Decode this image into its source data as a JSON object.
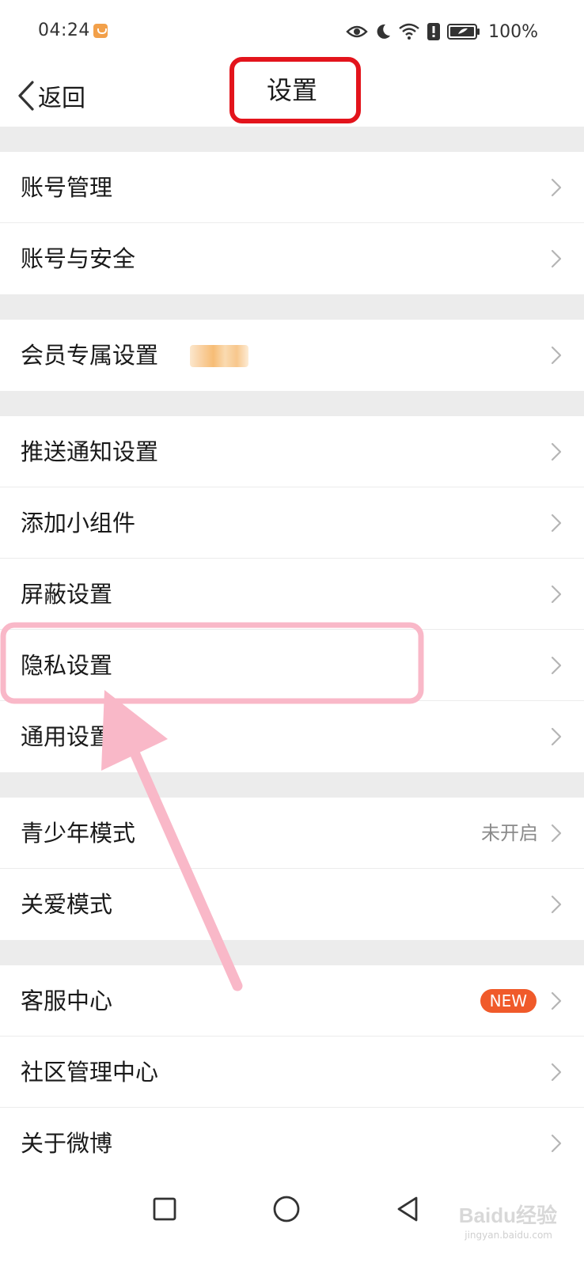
{
  "status_bar": {
    "time": "04:24",
    "battery_percent": "100%",
    "icons": [
      "weibo-app-icon",
      "eye-icon",
      "moon-icon",
      "wifi-icon",
      "alert-icon",
      "battery-icon"
    ]
  },
  "nav": {
    "back_label": "返回",
    "title": "设置"
  },
  "groups": [
    {
      "items": [
        {
          "label": "账号管理"
        },
        {
          "label": "账号与安全"
        }
      ]
    },
    {
      "items": [
        {
          "label": "会员专属设置"
        }
      ]
    },
    {
      "items": [
        {
          "label": "推送通知设置"
        },
        {
          "label": "添加小组件"
        },
        {
          "label": "屏蔽设置"
        },
        {
          "label": "隐私设置"
        },
        {
          "label": "通用设置"
        }
      ]
    },
    {
      "items": [
        {
          "label": "青少年模式",
          "value": "未开启"
        },
        {
          "label": "关爱模式"
        }
      ]
    },
    {
      "items": [
        {
          "label": "客服中心",
          "badge": "NEW"
        },
        {
          "label": "社区管理中心"
        },
        {
          "label": "关于微博"
        }
      ]
    }
  ],
  "colors": {
    "title_highlight": "#e3141c",
    "annotation_pink": "#f9b8c8",
    "new_badge": "#f05a2a",
    "divider": "#ececec"
  },
  "watermark": {
    "text": "Baidu经验",
    "sub": "jingyan.baidu.com"
  }
}
